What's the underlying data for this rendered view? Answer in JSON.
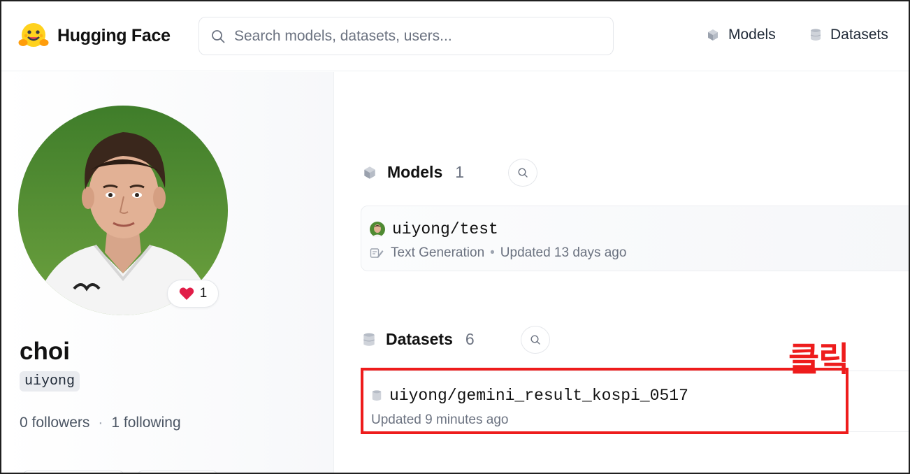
{
  "brand": {
    "name": "Hugging Face"
  },
  "search": {
    "placeholder": "Search models, datasets, users..."
  },
  "nav": {
    "models": "Models",
    "datasets": "Datasets"
  },
  "profile": {
    "display_name": "choi",
    "username": "uiyong",
    "likes": "1",
    "followers": "0 followers",
    "following": "1 following"
  },
  "models_section": {
    "title": "Models",
    "count": "1",
    "items": [
      {
        "name": "uiyong/test",
        "task": "Text Generation",
        "updated": "Updated 13 days ago"
      }
    ]
  },
  "datasets_section": {
    "title": "Datasets",
    "count": "6",
    "items": [
      {
        "name": "uiyong/gemini_result_kospi_0517",
        "updated": "Updated 9 minutes ago"
      }
    ]
  },
  "annotation": {
    "text": "클릭",
    "color": "#ee1c1c"
  },
  "colors": {
    "accent": "#ffd21e",
    "highlight": "#ee1c1c",
    "heart": "#e11d48"
  }
}
